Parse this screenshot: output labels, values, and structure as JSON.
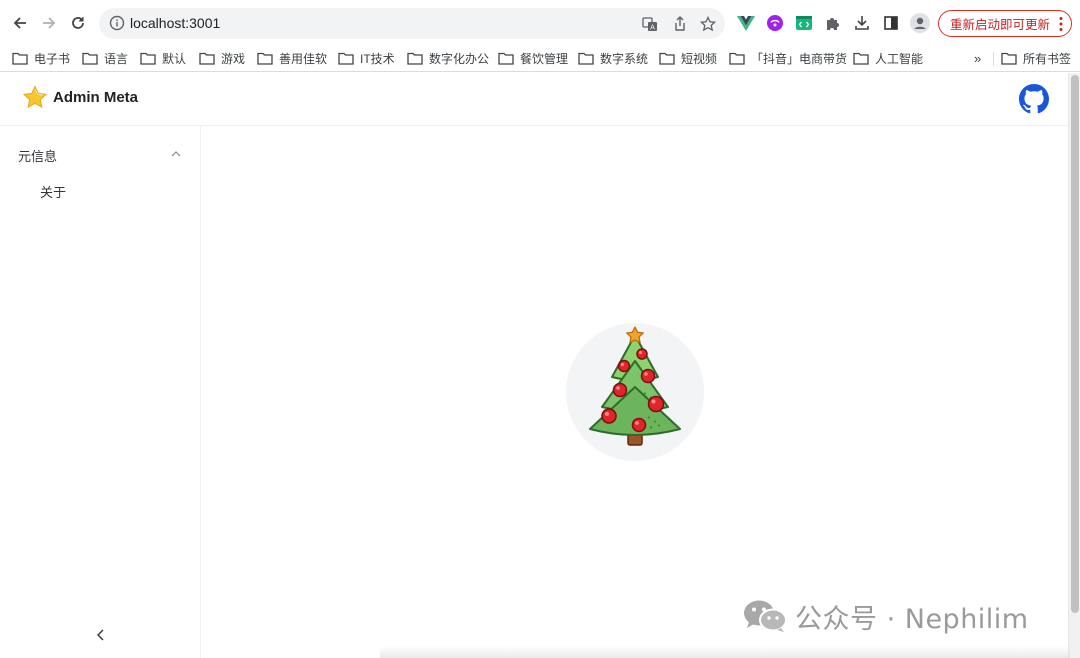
{
  "browser": {
    "url": "localhost:3001",
    "update_label": "重新启动即可更新"
  },
  "bookmarks": {
    "items": [
      "电子书",
      "语言",
      "默认",
      "游戏",
      "善用佳软",
      "IT技术",
      "数字化办公",
      "餐饮管理",
      "数字系统",
      "短视频",
      "「抖音」电商带货",
      "人工智能"
    ],
    "more": "»",
    "all": "所有书签"
  },
  "app": {
    "title": "Admin Meta",
    "menu_group_label": "元信息",
    "menu_item_label": "关于"
  },
  "watermark": {
    "text": "公众号 · Nephilim"
  },
  "colors": {
    "github": "#1a56db",
    "update_red": "#d93025",
    "tree_green": "#7cc36a",
    "ornament_red": "#e0262b",
    "star_orange": "#f0a22a"
  }
}
